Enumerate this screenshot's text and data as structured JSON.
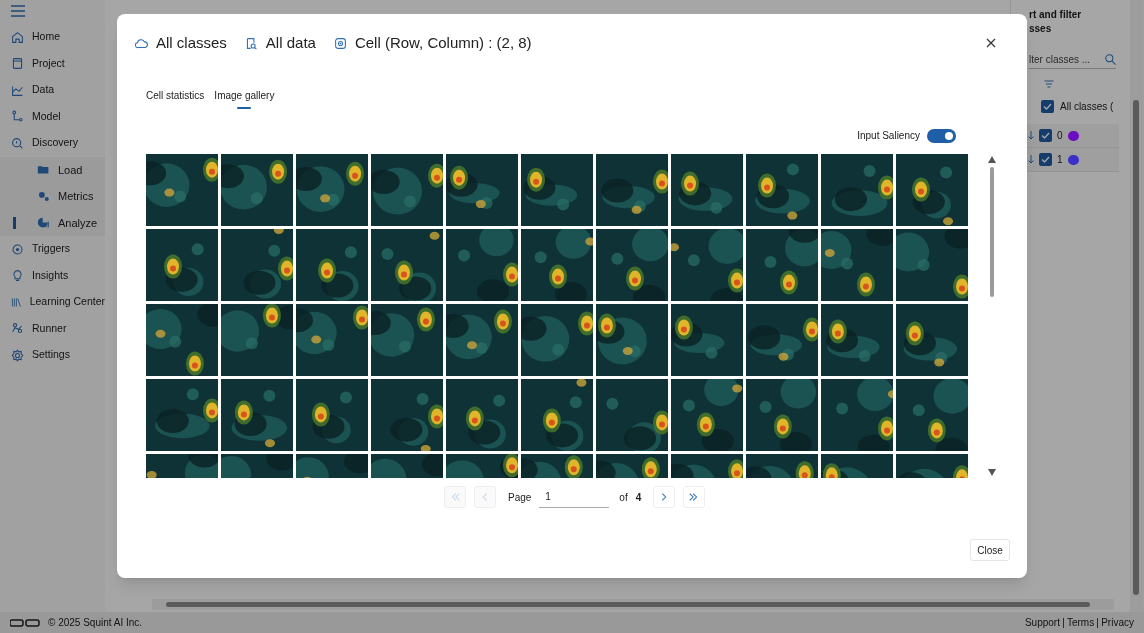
{
  "sidebar": {
    "items": [
      {
        "label": "Home",
        "selected": false
      },
      {
        "label": "Project",
        "selected": false
      },
      {
        "label": "Data",
        "selected": false
      },
      {
        "label": "Model",
        "selected": false
      },
      {
        "label": "Discovery",
        "selected": false,
        "expanded": true,
        "children": [
          {
            "label": "Load",
            "selected": false
          },
          {
            "label": "Metrics",
            "selected": false
          },
          {
            "label": "Analyze",
            "selected": true
          }
        ]
      },
      {
        "label": "Triggers",
        "selected": false
      },
      {
        "label": "Insights",
        "selected": false
      },
      {
        "label": "Learning Center",
        "selected": false
      },
      {
        "label": "Runner",
        "selected": false
      },
      {
        "label": "Settings",
        "selected": false
      }
    ]
  },
  "filter_panel": {
    "title_lines": [
      "rt and filter",
      "sses"
    ],
    "search_placeholder": "lter classes ...",
    "all_classes": {
      "label": "All classes (",
      "checked": true
    },
    "classes": [
      {
        "label": "0",
        "checked": true,
        "color": "#6a0dc4"
      },
      {
        "label": "1",
        "checked": true,
        "color": "#3b2fc9"
      }
    ]
  },
  "footer": {
    "copyright": "© 2025 Squint AI Inc.",
    "links": [
      "Support",
      "Terms",
      "Privacy"
    ]
  },
  "dialog": {
    "breadcrumbs": [
      "All classes",
      "All data",
      "Cell (Row, Column) : (2, 8)"
    ],
    "tabs": [
      {
        "label": "Cell statistics",
        "selected": false
      },
      {
        "label": "Image gallery",
        "selected": true
      }
    ],
    "saliency_toggle": {
      "label": "Input Saliency",
      "on": true
    },
    "gallery": {
      "rows": [
        {
          "images": [
            {
              "kind": "picture"
            },
            {
              "kind": "picture"
            },
            {
              "kind": "picture"
            },
            {
              "kind": "picture"
            },
            {
              "kind": "picture"
            },
            {
              "kind": "picture"
            },
            {
              "kind": "picture"
            },
            {
              "kind": "picture"
            },
            {
              "kind": "picture"
            },
            {
              "kind": "picture"
            },
            {
              "kind": "picture"
            }
          ]
        },
        {
          "images": [
            {
              "kind": "picture"
            },
            {
              "kind": "picture"
            },
            {
              "kind": "picture"
            },
            {
              "kind": "picture"
            },
            {
              "kind": "picture"
            },
            {
              "kind": "picture"
            },
            {
              "kind": "picture"
            },
            {
              "kind": "picture"
            },
            {
              "kind": "picture"
            },
            {
              "kind": "picture"
            },
            {
              "kind": "picture"
            }
          ]
        },
        {
          "images": [
            {
              "kind": "picture"
            },
            {
              "kind": "picture"
            },
            {
              "kind": "picture"
            },
            {
              "kind": "picture"
            },
            {
              "kind": "picture"
            },
            {
              "kind": "picture"
            },
            {
              "kind": "picture"
            },
            {
              "kind": "picture"
            },
            {
              "kind": "picture"
            },
            {
              "kind": "picture"
            },
            {
              "kind": "picture"
            }
          ]
        },
        {
          "images": [
            {
              "kind": "picture"
            },
            {
              "kind": "picture"
            },
            {
              "kind": "picture"
            },
            {
              "kind": "picture"
            },
            {
              "kind": "picture"
            },
            {
              "kind": "picture"
            },
            {
              "kind": "picture"
            },
            {
              "kind": "picture"
            },
            {
              "kind": "picture"
            },
            {
              "kind": "picture"
            },
            {
              "kind": "picture"
            }
          ]
        },
        {
          "images": [
            {
              "kind": "picture"
            },
            {
              "kind": "picture"
            },
            {
              "kind": "picture"
            },
            {
              "kind": "picture"
            },
            {
              "kind": "picture"
            },
            {
              "kind": "picture"
            },
            {
              "kind": "picture"
            },
            {
              "kind": "picture"
            },
            {
              "kind": "picture"
            },
            {
              "kind": "picture"
            },
            {
              "kind": "picture"
            }
          ]
        }
      ]
    },
    "pagination": {
      "buttons": [
        {
          "kind": "first",
          "disabled": true
        },
        {
          "kind": "prev",
          "disabled": true
        },
        {
          "kind": "next",
          "disabled": false
        },
        {
          "kind": "last",
          "disabled": false
        }
      ],
      "page_label": "Page",
      "page_value": "1",
      "of_label": "of",
      "total": "4"
    },
    "close_button": "Close"
  }
}
